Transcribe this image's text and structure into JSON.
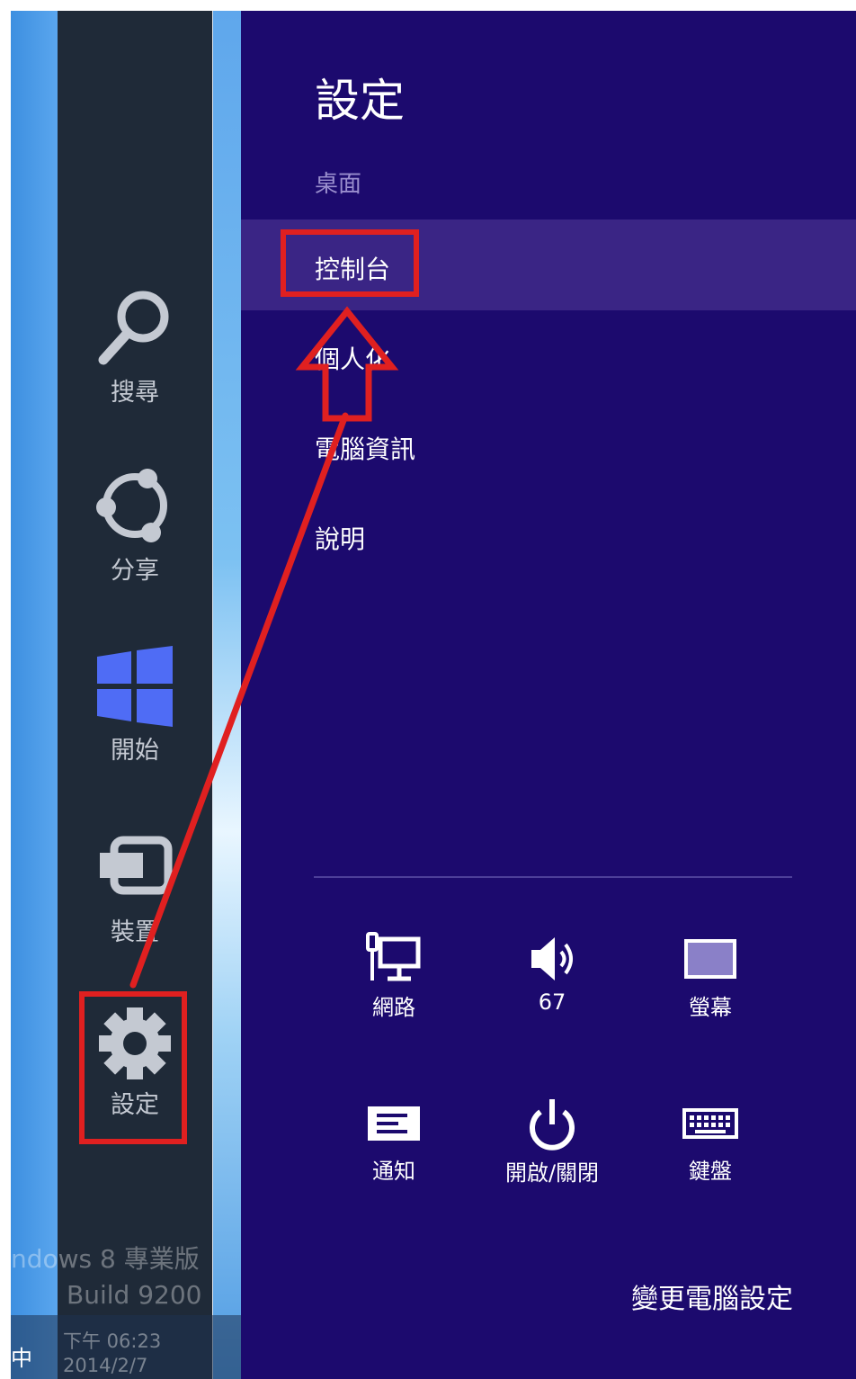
{
  "desktop": {
    "watermark_line1": "ndows 8 專業版",
    "watermark_line2": "Build 9200",
    "clock_time": "下午 06:23",
    "clock_date": "2014/2/7",
    "ime": "中"
  },
  "charms": [
    {
      "label": "搜尋",
      "icon": "search-icon"
    },
    {
      "label": "分享",
      "icon": "share-icon"
    },
    {
      "label": "開始",
      "icon": "windows-logo-icon"
    },
    {
      "label": "裝置",
      "icon": "devices-icon"
    },
    {
      "label": "設定",
      "icon": "gear-icon"
    }
  ],
  "settings_pane": {
    "title": "設定",
    "subtitle": "桌面",
    "menu": [
      "控制台",
      "個人化",
      "電腦資訊",
      "說明"
    ],
    "tiles": [
      {
        "label": "網路",
        "icon": "network-icon"
      },
      {
        "label": "67",
        "icon": "volume-icon"
      },
      {
        "label": "螢幕",
        "icon": "screen-icon"
      },
      {
        "label": "通知",
        "icon": "notifications-icon"
      },
      {
        "label": "開啟/關閉",
        "icon": "power-icon"
      },
      {
        "label": "鍵盤",
        "icon": "keyboard-icon"
      }
    ],
    "change_settings": "變更電腦設定"
  },
  "colors": {
    "pane_bg": "#1c0a6e",
    "highlight": "#3a2585",
    "charms_bg": "#1f2a38",
    "annotation": "#e02020",
    "windows_logo": "#4f6cf5"
  }
}
